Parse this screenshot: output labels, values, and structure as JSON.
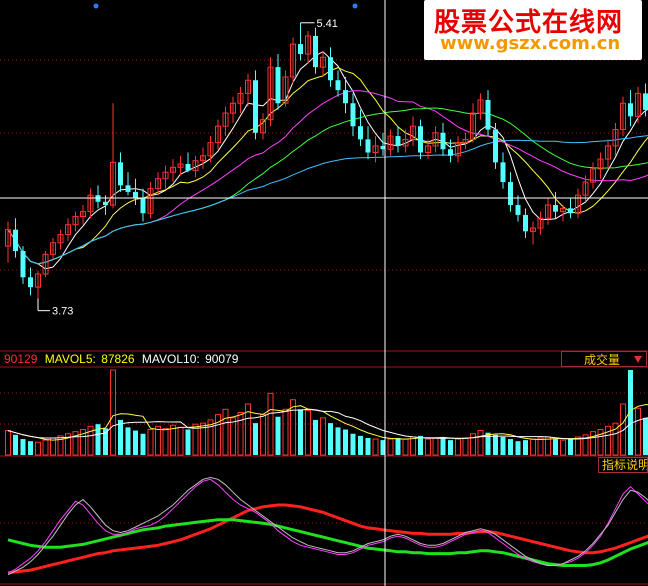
{
  "watermark": {
    "title": "股票公式在线网",
    "url": "www.gszx.com.cn"
  },
  "volume_panel": {
    "main_value": "90129",
    "mavol5_label": "MAVOL5:",
    "mavol5_value": "87826",
    "mavol10_label": "MAVOL10:",
    "mavol10_value": "90079",
    "tag": "成交量"
  },
  "indicator_panel": {
    "tag": "指标说明"
  },
  "colors": {
    "up": "#ff3232",
    "down": "#54ffff",
    "crosshair": "#ffffff",
    "grid": "#a01818"
  },
  "chart_data": [
    {
      "type": "candlestick",
      "title": "",
      "annotations": [
        {
          "label": "5.41",
          "kind": "high"
        },
        {
          "label": "3.73",
          "kind": "low"
        }
      ],
      "ylim": [
        3.6,
        5.5
      ],
      "grid": "dotted horizontal",
      "candles": [
        [
          4.05,
          4.2,
          3.95,
          4.15
        ],
        [
          4.15,
          4.22,
          3.98,
          4.02
        ],
        [
          4.02,
          4.05,
          3.82,
          3.86
        ],
        [
          3.86,
          3.92,
          3.75,
          3.8
        ],
        [
          3.8,
          3.9,
          3.73,
          3.88
        ],
        [
          3.88,
          4.02,
          3.86,
          4.0
        ],
        [
          4.0,
          4.1,
          3.97,
          4.07
        ],
        [
          4.07,
          4.15,
          4.03,
          4.12
        ],
        [
          4.12,
          4.22,
          4.08,
          4.18
        ],
        [
          4.18,
          4.26,
          4.14,
          4.23
        ],
        [
          4.23,
          4.3,
          4.18,
          4.26
        ],
        [
          4.26,
          4.4,
          4.22,
          4.36
        ],
        [
          4.36,
          4.42,
          4.28,
          4.32
        ],
        [
          4.32,
          4.36,
          4.24,
          4.3
        ],
        [
          4.3,
          4.92,
          4.28,
          4.56
        ],
        [
          4.56,
          4.62,
          4.38,
          4.42
        ],
        [
          4.42,
          4.5,
          4.36,
          4.38
        ],
        [
          4.38,
          4.46,
          4.3,
          4.34
        ],
        [
          4.34,
          4.4,
          4.2,
          4.25
        ],
        [
          4.25,
          4.44,
          4.22,
          4.4
        ],
        [
          4.4,
          4.5,
          4.36,
          4.46
        ],
        [
          4.46,
          4.54,
          4.4,
          4.5
        ],
        [
          4.5,
          4.58,
          4.44,
          4.53
        ],
        [
          4.53,
          4.6,
          4.48,
          4.55
        ],
        [
          4.55,
          4.62,
          4.5,
          4.51
        ],
        [
          4.51,
          4.6,
          4.47,
          4.57
        ],
        [
          4.57,
          4.65,
          4.52,
          4.6
        ],
        [
          4.6,
          4.72,
          4.56,
          4.68
        ],
        [
          4.68,
          4.82,
          4.64,
          4.78
        ],
        [
          4.78,
          4.9,
          4.72,
          4.86
        ],
        [
          4.86,
          4.96,
          4.8,
          4.92
        ],
        [
          4.92,
          5.02,
          4.86,
          4.98
        ],
        [
          4.98,
          5.1,
          4.9,
          5.06
        ],
        [
          5.06,
          5.12,
          4.7,
          4.74
        ],
        [
          4.74,
          4.86,
          4.7,
          4.82
        ],
        [
          4.82,
          5.2,
          4.78,
          5.14
        ],
        [
          5.14,
          5.22,
          4.88,
          4.92
        ],
        [
          4.92,
          5.12,
          4.9,
          5.08
        ],
        [
          5.08,
          5.32,
          5.04,
          5.28
        ],
        [
          5.28,
          5.41,
          5.18,
          5.22
        ],
        [
          5.22,
          5.36,
          5.16,
          5.33
        ],
        [
          5.33,
          5.38,
          5.1,
          5.14
        ],
        [
          5.14,
          5.24,
          5.08,
          5.2
        ],
        [
          5.2,
          5.26,
          5.02,
          5.06
        ],
        [
          5.06,
          5.12,
          4.96,
          5.0
        ],
        [
          5.0,
          5.08,
          4.86,
          4.92
        ],
        [
          4.92,
          4.98,
          4.72,
          4.78
        ],
        [
          4.78,
          4.88,
          4.66,
          4.7
        ],
        [
          4.7,
          4.78,
          4.58,
          4.62
        ],
        [
          4.62,
          4.72,
          4.56,
          4.66
        ],
        [
          4.66,
          4.74,
          4.6,
          4.64
        ],
        [
          4.64,
          4.76,
          4.6,
          4.72
        ],
        [
          4.72,
          4.78,
          4.62,
          4.66
        ],
        [
          4.66,
          4.76,
          4.62,
          4.7
        ],
        [
          4.7,
          4.84,
          4.66,
          4.78
        ],
        [
          4.78,
          4.82,
          4.58,
          4.62
        ],
        [
          4.62,
          4.7,
          4.58,
          4.66
        ],
        [
          4.66,
          4.78,
          4.62,
          4.74
        ],
        [
          4.74,
          4.8,
          4.6,
          4.64
        ],
        [
          4.64,
          4.7,
          4.56,
          4.6
        ],
        [
          4.6,
          4.72,
          4.56,
          4.68
        ],
        [
          4.68,
          4.74,
          4.64,
          4.7
        ],
        [
          4.7,
          4.92,
          4.68,
          4.86
        ],
        [
          4.86,
          4.98,
          4.82,
          4.94
        ],
        [
          4.94,
          5.0,
          4.72,
          4.76
        ],
        [
          4.76,
          4.8,
          4.52,
          4.56
        ],
        [
          4.56,
          4.62,
          4.4,
          4.44
        ],
        [
          4.44,
          4.5,
          4.26,
          4.3
        ],
        [
          4.3,
          4.36,
          4.2,
          4.24
        ],
        [
          4.24,
          4.28,
          4.1,
          4.14
        ],
        [
          4.14,
          4.2,
          4.06,
          4.16
        ],
        [
          4.16,
          4.26,
          4.12,
          4.22
        ],
        [
          4.22,
          4.34,
          4.18,
          4.3
        ],
        [
          4.3,
          4.38,
          4.22,
          4.26
        ],
        [
          4.26,
          4.3,
          4.2,
          4.28
        ],
        [
          4.28,
          4.34,
          4.22,
          4.25
        ],
        [
          4.25,
          4.4,
          4.22,
          4.36
        ],
        [
          4.36,
          4.48,
          4.32,
          4.44
        ],
        [
          4.44,
          4.56,
          4.4,
          4.52
        ],
        [
          4.52,
          4.62,
          4.46,
          4.58
        ],
        [
          4.58,
          4.7,
          4.52,
          4.66
        ],
        [
          4.66,
          4.8,
          4.6,
          4.76
        ],
        [
          4.76,
          4.96,
          4.72,
          4.92
        ],
        [
          4.92,
          5.0,
          4.78,
          4.84
        ],
        [
          4.84,
          5.02,
          4.8,
          4.98
        ],
        [
          4.98,
          5.04,
          4.84,
          4.88
        ],
        [
          4.88,
          4.94,
          4.8,
          4.86
        ]
      ]
    },
    {
      "type": "bar",
      "title": "成交量",
      "series": [
        {
          "name": "MAVOL5"
        },
        {
          "name": "MAVOL10"
        }
      ],
      "values": [
        46,
        38,
        30,
        26,
        24,
        28,
        32,
        36,
        40,
        44,
        48,
        54,
        58,
        50,
        160,
        66,
        52,
        46,
        40,
        48,
        54,
        50,
        56,
        52,
        48,
        58,
        60,
        66,
        76,
        86,
        70,
        80,
        96,
        60,
        76,
        116,
        72,
        86,
        104,
        86,
        84,
        66,
        70,
        60,
        52,
        48,
        40,
        36,
        32,
        30,
        28,
        30,
        32,
        30,
        34,
        36,
        30,
        32,
        34,
        28,
        30,
        32,
        40,
        46,
        42,
        38,
        34,
        30,
        26,
        28,
        30,
        32,
        34,
        30,
        28,
        30,
        34,
        38,
        44,
        48,
        54,
        60,
        96,
        160,
        88,
        70,
        60
      ]
    },
    {
      "type": "line",
      "title": "",
      "series": [
        {
          "name": "",
          "color": "#ff2020",
          "values": [
            10,
            11,
            12,
            13,
            15,
            17,
            19,
            21,
            23,
            25,
            27,
            29,
            31,
            32,
            34,
            35,
            36,
            37,
            38,
            39,
            40,
            42,
            44,
            46,
            49,
            52,
            55,
            58,
            62,
            66,
            70,
            74,
            78,
            80,
            82,
            83,
            84,
            84,
            83,
            82,
            80,
            78,
            76,
            73,
            70,
            67,
            64,
            61,
            59,
            58,
            57,
            56,
            55,
            54,
            53,
            53,
            52,
            52,
            52,
            52,
            53,
            53,
            54,
            55,
            55,
            54,
            52,
            50,
            48,
            46,
            44,
            42,
            40,
            38,
            36,
            34,
            33,
            32,
            32,
            33,
            35,
            37,
            40,
            43,
            46,
            49,
            52
          ]
        },
        {
          "name": "",
          "color": "#20e020",
          "values": [
            46,
            44,
            42,
            40,
            39,
            38,
            38,
            38,
            39,
            40,
            41,
            43,
            45,
            47,
            49,
            51,
            53,
            55,
            57,
            58,
            59,
            61,
            62,
            63,
            64,
            65,
            66,
            67,
            68,
            68,
            68,
            67,
            66,
            65,
            64,
            63,
            61,
            59,
            57,
            55,
            53,
            51,
            49,
            47,
            45,
            43,
            41,
            39,
            37,
            36,
            35,
            34,
            33,
            33,
            32,
            32,
            31,
            31,
            31,
            31,
            32,
            32,
            33,
            34,
            34,
            33,
            32,
            30,
            28,
            26,
            24,
            22,
            20,
            19,
            18,
            18,
            18,
            18,
            19,
            21,
            24,
            28,
            32,
            36,
            39,
            42,
            45
          ]
        },
        {
          "name": "",
          "color": "#ff40ff",
          "values": [
            10,
            14,
            20,
            26,
            34,
            44,
            56,
            68,
            78,
            88,
            84,
            74,
            64,
            56,
            52,
            52,
            54,
            58,
            60,
            62,
            66,
            72,
            80,
            88,
            96,
            104,
            110,
            112,
            106,
            98,
            90,
            84,
            80,
            76,
            70,
            64,
            56,
            50,
            44,
            40,
            38,
            36,
            34,
            32,
            30,
            30,
            32,
            36,
            40,
            42,
            44,
            48,
            50,
            48,
            44,
            40,
            38,
            38,
            40,
            44,
            48,
            52,
            54,
            56,
            54,
            48,
            42,
            36,
            30,
            26,
            22,
            20,
            18,
            18,
            20,
            22,
            26,
            32,
            40,
            50,
            64,
            80,
            96,
            104,
            96,
            88,
            80
          ]
        },
        {
          "name": "",
          "color": "#c0c0c0",
          "values": [
            8,
            12,
            16,
            22,
            30,
            40,
            50,
            62,
            74,
            84,
            90,
            82,
            72,
            62,
            56,
            54,
            56,
            60,
            64,
            68,
            72,
            78,
            84,
            92,
            100,
            106,
            112,
            114,
            112,
            106,
            98,
            90,
            84,
            78,
            72,
            66,
            60,
            54,
            48,
            44,
            40,
            38,
            36,
            34,
            32,
            32,
            34,
            38,
            42,
            44,
            46,
            50,
            52,
            50,
            46,
            42,
            40,
            40,
            42,
            46,
            50,
            54,
            56,
            58,
            56,
            52,
            46,
            40,
            34,
            28,
            24,
            20,
            18,
            18,
            20,
            24,
            28,
            34,
            42,
            52,
            62,
            76,
            90,
            100,
            98,
            92,
            84
          ]
        }
      ]
    }
  ]
}
